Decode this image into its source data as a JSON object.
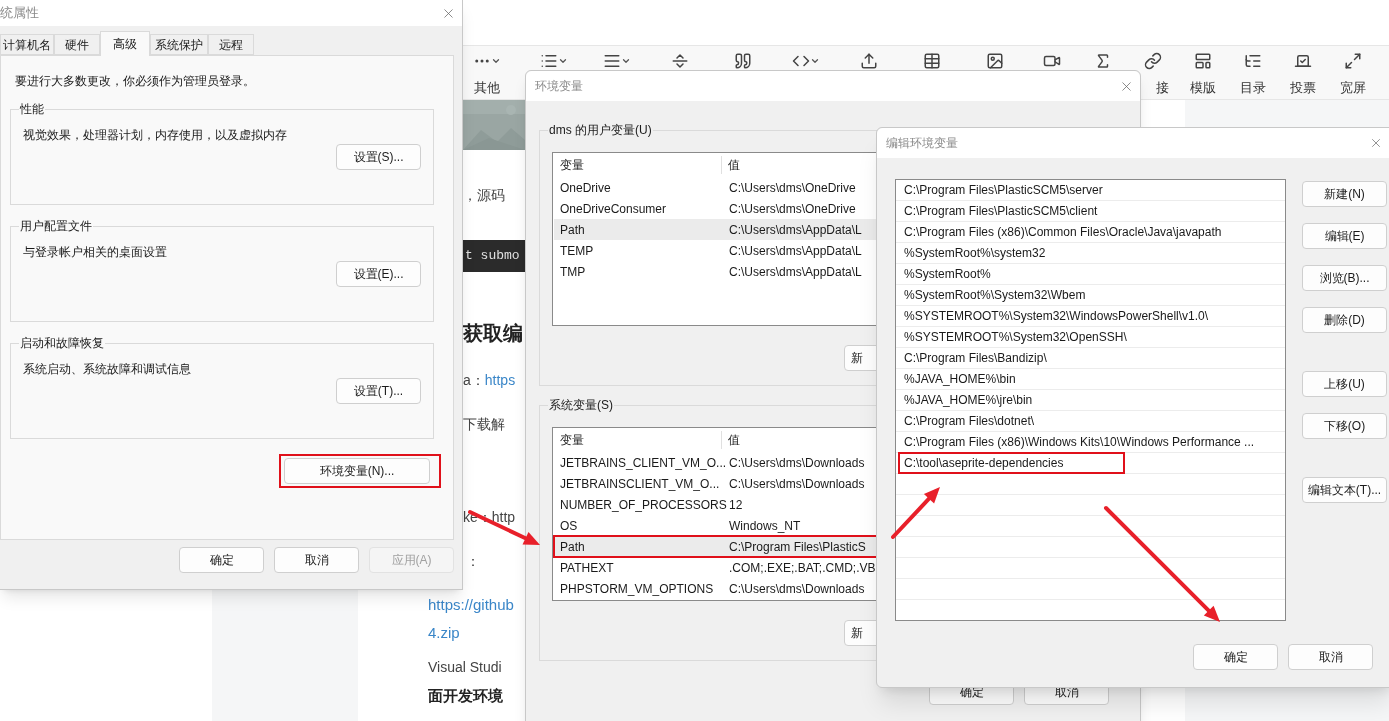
{
  "editor_toolbar": {
    "more_label": "其他",
    "right_labels": [
      "接",
      "模版",
      "目录",
      "投票",
      "宽屏"
    ]
  },
  "article": [
    {
      "kind": "picture"
    },
    {
      "kind": "text",
      "text": "，源码"
    },
    {
      "kind": "code",
      "text": "t submo"
    },
    {
      "kind": "heading",
      "text": "获取编"
    },
    {
      "kind": "link_line",
      "prefix": "a：",
      "link": "https"
    },
    {
      "kind": "text",
      "text": "下载解"
    },
    {
      "kind": "text",
      "text": "ke：http"
    },
    {
      "kind": "text",
      "text": "："
    },
    {
      "kind": "link",
      "text": "https://github"
    },
    {
      "kind": "link",
      "text": "4.zip"
    },
    {
      "kind": "text",
      "text": "Visual Studi"
    },
    {
      "kind": "bold",
      "text": "面开发环境"
    }
  ],
  "system_properties": {
    "title": "统属性",
    "tabs": [
      {
        "label": "计算机名",
        "selected": false
      },
      {
        "label": "硬件",
        "selected": false
      },
      {
        "label": "高级",
        "selected": true
      },
      {
        "label": "系统保护",
        "selected": false
      },
      {
        "label": "远程",
        "selected": false
      }
    ],
    "admin_note": "要进行大多数更改，你必须作为管理员登录。",
    "groups": [
      {
        "legend": "性能",
        "description": "视觉效果，处理器计划，内存使用，以及虚拟内存",
        "button": "设置(S)..."
      },
      {
        "legend": "用户配置文件",
        "description": "与登录帐户相关的桌面设置",
        "button": "设置(E)..."
      },
      {
        "legend": "启动和故障恢复",
        "description": "系统启动、系统故障和调试信息",
        "button": "设置(T)..."
      }
    ],
    "env_button": {
      "label": "环境变量(N)...",
      "highlighted": true
    },
    "buttons": [
      {
        "label": "确定",
        "disabled": false
      },
      {
        "label": "取消",
        "disabled": false
      },
      {
        "label": "应用(A)",
        "disabled": true
      }
    ]
  },
  "environment_variables": {
    "title": "环境变量",
    "user_vars": {
      "legend": "dms 的用户变量(U)",
      "columns": [
        "变量",
        "值"
      ],
      "rows": [
        {
          "name": "OneDrive",
          "value": "C:\\Users\\dms\\OneDrive",
          "selected": false,
          "highlighted": false
        },
        {
          "name": "OneDriveConsumer",
          "value": "C:\\Users\\dms\\OneDrive",
          "selected": false,
          "highlighted": false
        },
        {
          "name": "Path",
          "value": "C:\\Users\\dms\\AppData\\L",
          "selected": true,
          "highlighted": false
        },
        {
          "name": "TEMP",
          "value": "C:\\Users\\dms\\AppData\\L",
          "selected": false,
          "highlighted": false
        },
        {
          "name": "TMP",
          "value": "C:\\Users\\dms\\AppData\\L",
          "selected": false,
          "highlighted": false
        }
      ],
      "button": "新"
    },
    "system_vars": {
      "legend": "系统变量(S)",
      "columns": [
        "变量",
        "值"
      ],
      "rows": [
        {
          "name": "JETBRAINS_CLIENT_VM_O...",
          "value": "C:\\Users\\dms\\Downloads",
          "selected": false,
          "highlighted": false
        },
        {
          "name": "JETBRAINSCLIENT_VM_O...",
          "value": "C:\\Users\\dms\\Downloads",
          "selected": false,
          "highlighted": false
        },
        {
          "name": "NUMBER_OF_PROCESSORS",
          "value": "12",
          "selected": false,
          "highlighted": false
        },
        {
          "name": "OS",
          "value": "Windows_NT",
          "selected": false,
          "highlighted": false
        },
        {
          "name": "Path",
          "value": "C:\\Program Files\\PlasticS",
          "selected": true,
          "highlighted": true
        },
        {
          "name": "PATHEXT",
          "value": ".COM;.EXE;.BAT;.CMD;.VB",
          "selected": false,
          "highlighted": false
        },
        {
          "name": "PHPSTORM_VM_OPTIONS",
          "value": "C:\\Users\\dms\\Downloads",
          "selected": false,
          "highlighted": false
        }
      ],
      "button": "新"
    },
    "buttons": [
      "确定",
      "取消"
    ]
  },
  "edit_environment_variable": {
    "title": "编辑环境变量",
    "entries": [
      {
        "text": "C:\\Program Files\\PlasticSCM5\\server",
        "highlighted": false
      },
      {
        "text": "C:\\Program Files\\PlasticSCM5\\client",
        "highlighted": false
      },
      {
        "text": "C:\\Program Files (x86)\\Common Files\\Oracle\\Java\\javapath",
        "highlighted": false
      },
      {
        "text": "%SystemRoot%\\system32",
        "highlighted": false
      },
      {
        "text": "%SystemRoot%",
        "highlighted": false
      },
      {
        "text": "%SystemRoot%\\System32\\Wbem",
        "highlighted": false
      },
      {
        "text": "%SYSTEMROOT%\\System32\\WindowsPowerShell\\v1.0\\",
        "highlighted": false
      },
      {
        "text": "%SYSTEMROOT%\\System32\\OpenSSH\\",
        "highlighted": false
      },
      {
        "text": "C:\\Program Files\\Bandizip\\",
        "highlighted": false
      },
      {
        "text": "%JAVA_HOME%\\bin",
        "highlighted": false
      },
      {
        "text": "%JAVA_HOME%\\jre\\bin",
        "highlighted": false
      },
      {
        "text": "C:\\Program Files\\dotnet\\",
        "highlighted": false
      },
      {
        "text": "C:\\Program Files (x86)\\Windows Kits\\10\\Windows Performance ...",
        "highlighted": false
      },
      {
        "text": "C:\\tool\\aseprite-dependencies",
        "highlighted": true
      }
    ],
    "side_buttons": [
      [
        "新建(N)",
        "编辑(E)",
        "浏览(B)...",
        "删除(D)"
      ],
      [
        "上移(U)",
        "下移(O)"
      ],
      [
        "编辑文本(T)..."
      ]
    ],
    "buttons": [
      "确定",
      "取消"
    ]
  }
}
